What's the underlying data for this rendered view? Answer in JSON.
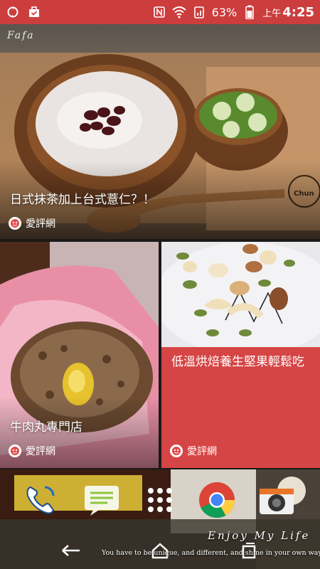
{
  "status_bar": {
    "battery": "63%",
    "ampm": "上午",
    "time": "4:25",
    "icons": [
      "sync-icon",
      "briefcase-icon",
      "nfc-icon",
      "wifi-icon",
      "signal-icon",
      "battery-icon"
    ],
    "background_color": "#cc3d3d"
  },
  "feed": {
    "cards": [
      {
        "title": "日式抹茶加上台式薏仁？！",
        "source": "愛評網"
      },
      {
        "title": "牛肉丸專門店",
        "source": "愛評網"
      },
      {
        "title": "低溫烘焙養生堅果輕鬆吃",
        "source": "愛評網"
      }
    ],
    "photo_tag": "Fafa",
    "accent_color": "#d64545"
  },
  "dock": {
    "apps": [
      "phone-icon",
      "messages-icon",
      "app-drawer-icon",
      "chrome-icon",
      "camera-icon"
    ]
  },
  "watermark": {
    "title": "Enjoy My Life",
    "subtitle": "You have to be unique, and different, and shine in your own way."
  },
  "nav": {
    "buttons": [
      "back-icon",
      "home-icon",
      "recents-icon"
    ]
  }
}
